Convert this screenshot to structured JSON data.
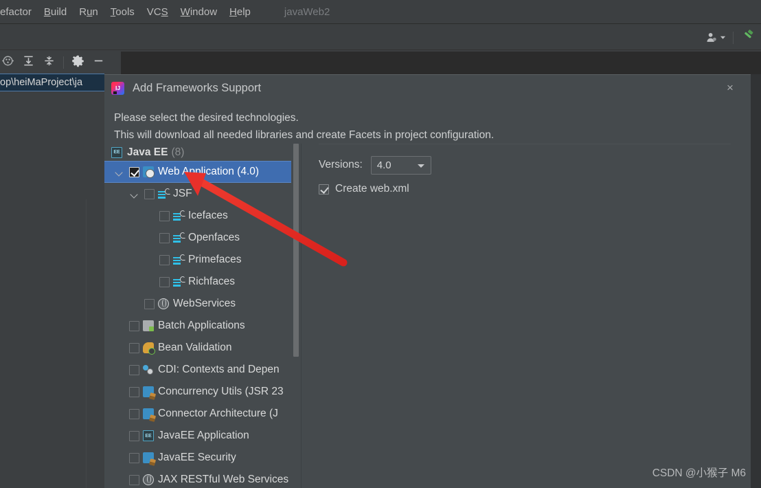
{
  "ide": {
    "menu_items": [
      {
        "label": "efactor",
        "mnemonic": "",
        "cut": true
      },
      {
        "label": "Build",
        "mnemonic": "B"
      },
      {
        "label": "Run",
        "mnemonic": "u"
      },
      {
        "label": "Tools",
        "mnemonic": "T"
      },
      {
        "label": "VCS",
        "mnemonic": "S"
      },
      {
        "label": "Window",
        "mnemonic": "W"
      },
      {
        "label": "Help",
        "mnemonic": "H"
      }
    ],
    "project_name": "javaWeb2",
    "path_chip": "op\\heiMaProject\\ja",
    "toolbar_right_icons": [
      "user-account-icon",
      "chevron-down-icon",
      "build-hammer-icon"
    ],
    "strip2_icons": [
      "locate-icon",
      "expand-all-icon",
      "collapse-all-icon",
      "settings-gear-icon",
      "hide-icon"
    ]
  },
  "dialog": {
    "title": "Add Frameworks Support",
    "close_label": "×",
    "description_line1": "Please select the desired technologies.",
    "description_line2": "This will download all needed libraries and create Facets in project configuration.",
    "tree": {
      "group_label": "Java EE",
      "group_count": "(8)",
      "group_icon": "javaee-icon",
      "items": [
        {
          "label": "Web Application (4.0)",
          "indent": 0,
          "checked": true,
          "selected": true,
          "twisty": true,
          "icon": "web-application-icon"
        },
        {
          "label": "JSF",
          "indent": 1,
          "checked": false,
          "selected": false,
          "twisty": true,
          "icon": "jsf-icon"
        },
        {
          "label": "Icefaces",
          "indent": 2,
          "checked": false,
          "selected": false,
          "twisty": false,
          "icon": "jsf-icon"
        },
        {
          "label": "Openfaces",
          "indent": 2,
          "checked": false,
          "selected": false,
          "twisty": false,
          "icon": "jsf-icon"
        },
        {
          "label": "Primefaces",
          "indent": 2,
          "checked": false,
          "selected": false,
          "twisty": false,
          "icon": "jsf-icon"
        },
        {
          "label": "Richfaces",
          "indent": 2,
          "checked": false,
          "selected": false,
          "twisty": false,
          "icon": "jsf-icon"
        },
        {
          "label": "WebServices",
          "indent": 1,
          "checked": false,
          "selected": false,
          "twisty": false,
          "icon": "globe-icon"
        },
        {
          "label": "Batch Applications",
          "indent": 0,
          "checked": false,
          "selected": false,
          "twisty": false,
          "icon": "folder-icon"
        },
        {
          "label": "Bean Validation",
          "indent": 0,
          "checked": false,
          "selected": false,
          "twisty": false,
          "icon": "bean-validation-icon"
        },
        {
          "label": "CDI: Contexts and Depen",
          "indent": 0,
          "checked": false,
          "selected": false,
          "twisty": false,
          "icon": "cdi-icon"
        },
        {
          "label": "Concurrency Utils (JSR 23",
          "indent": 0,
          "checked": false,
          "selected": false,
          "twisty": false,
          "icon": "connector-icon"
        },
        {
          "label": "Connector Architecture (J",
          "indent": 0,
          "checked": false,
          "selected": false,
          "twisty": false,
          "icon": "connector-icon"
        },
        {
          "label": "JavaEE Application",
          "indent": 0,
          "checked": false,
          "selected": false,
          "twisty": false,
          "icon": "javaee-icon"
        },
        {
          "label": "JavaEE Security",
          "indent": 0,
          "checked": false,
          "selected": false,
          "twisty": false,
          "icon": "connector-icon"
        },
        {
          "label": "JAX RESTful Web Services",
          "indent": 0,
          "checked": false,
          "selected": false,
          "twisty": false,
          "icon": "globe-icon"
        }
      ]
    },
    "config": {
      "versions_label": "Versions:",
      "versions_value": "4.0",
      "create_webxml_label": "Create web.xml",
      "create_webxml_checked": true
    }
  },
  "annotation": {
    "arrow_color": "#e8302a"
  },
  "watermark": "CSDN @小猴子 M6"
}
